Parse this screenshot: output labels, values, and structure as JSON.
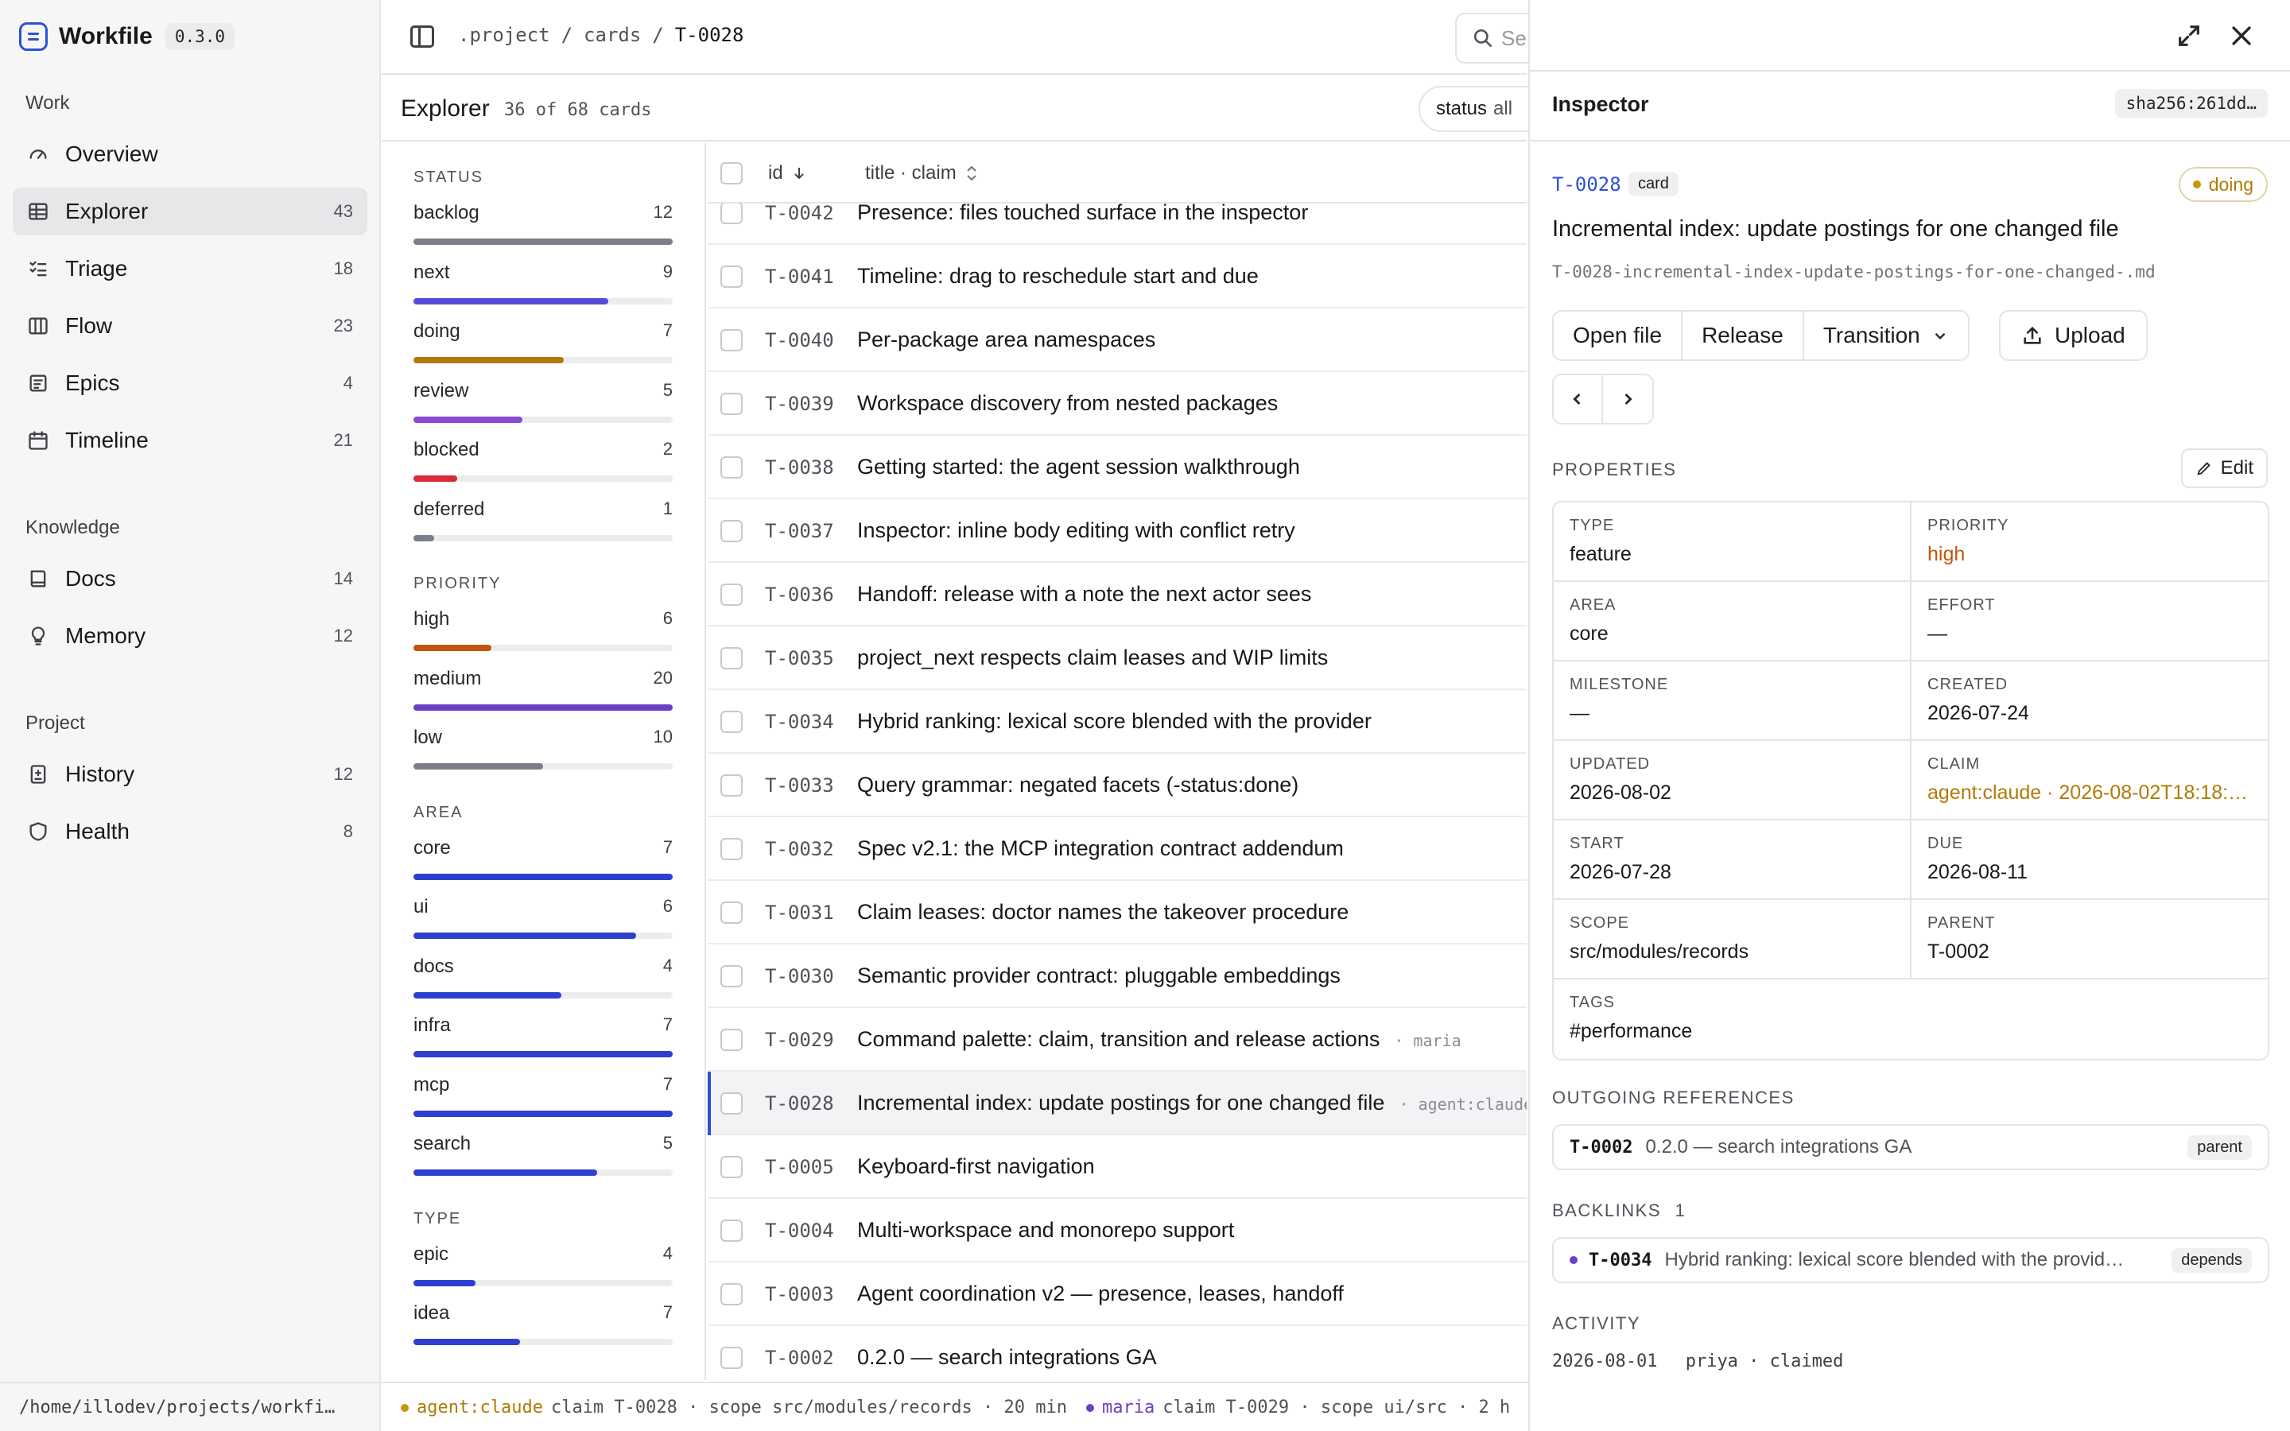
{
  "app": {
    "name": "Workfile",
    "version": "0.3.0"
  },
  "colors": {
    "accent": "#2f4fd8",
    "doing": "#b07a06",
    "high": "#c2560c",
    "purple": "#6d3fc4"
  },
  "sidebar": {
    "sections": [
      {
        "title": "Work",
        "items": [
          {
            "label": "Overview",
            "count": "",
            "icon": "gauge-icon"
          },
          {
            "label": "Explorer",
            "count": "43",
            "icon": "table-icon",
            "active": true
          },
          {
            "label": "Triage",
            "count": "18",
            "icon": "checklist-icon"
          },
          {
            "label": "Flow",
            "count": "23",
            "icon": "columns-icon"
          },
          {
            "label": "Epics",
            "count": "4",
            "icon": "epic-icon"
          },
          {
            "label": "Timeline",
            "count": "21",
            "icon": "calendar-icon"
          }
        ]
      },
      {
        "title": "Knowledge",
        "items": [
          {
            "label": "Docs",
            "count": "14",
            "icon": "book-icon"
          },
          {
            "label": "Memory",
            "count": "12",
            "icon": "bulb-icon"
          }
        ]
      },
      {
        "title": "Project",
        "items": [
          {
            "label": "History",
            "count": "12",
            "icon": "history-icon"
          },
          {
            "label": "Health",
            "count": "8",
            "icon": "shield-icon"
          }
        ]
      }
    ]
  },
  "topbar": {
    "breadcrumb": [
      ".project",
      "/",
      "cards",
      "/",
      "T-0028"
    ],
    "search_placeholder": "Se"
  },
  "explorer": {
    "title": "Explorer",
    "subtitle": "36 of 68 cards",
    "filter": {
      "label": "status",
      "value": "all"
    }
  },
  "facets": [
    {
      "head": "STATUS",
      "items": [
        {
          "label": "backlog",
          "count": "12",
          "fraction": 1.0,
          "color": "#7b7f8a"
        },
        {
          "label": "next",
          "count": "9",
          "fraction": 0.75,
          "color": "#5b4ad6"
        },
        {
          "label": "doing",
          "count": "7",
          "fraction": 0.58,
          "color": "#b07a06"
        },
        {
          "label": "review",
          "count": "5",
          "fraction": 0.42,
          "color": "#8b4ad6"
        },
        {
          "label": "blocked",
          "count": "2",
          "fraction": 0.17,
          "color": "#d92b3a"
        },
        {
          "label": "deferred",
          "count": "1",
          "fraction": 0.08,
          "color": "#7b7f8a"
        }
      ]
    },
    {
      "head": "PRIORITY",
      "items": [
        {
          "label": "high",
          "count": "6",
          "fraction": 0.3,
          "color": "#c2560c"
        },
        {
          "label": "medium",
          "count": "20",
          "fraction": 1.0,
          "color": "#6d3fc4"
        },
        {
          "label": "low",
          "count": "10",
          "fraction": 0.5,
          "color": "#7b7f8a"
        }
      ]
    },
    {
      "head": "AREA",
      "items": [
        {
          "label": "core",
          "count": "7",
          "fraction": 1.0,
          "color": "#2f3fd0"
        },
        {
          "label": "ui",
          "count": "6",
          "fraction": 0.86,
          "color": "#2f3fd0"
        },
        {
          "label": "docs",
          "count": "4",
          "fraction": 0.57,
          "color": "#2f3fd0"
        },
        {
          "label": "infra",
          "count": "7",
          "fraction": 1.0,
          "color": "#2f3fd0"
        },
        {
          "label": "mcp",
          "count": "7",
          "fraction": 1.0,
          "color": "#2f3fd0"
        },
        {
          "label": "search",
          "count": "5",
          "fraction": 0.71,
          "color": "#2f3fd0"
        }
      ]
    },
    {
      "head": "TYPE",
      "items": [
        {
          "label": "epic",
          "count": "4",
          "fraction": 0.24,
          "color": "#2f3fd0"
        },
        {
          "label": "idea",
          "count": "7",
          "fraction": 0.41,
          "color": "#2f3fd0"
        }
      ]
    }
  ],
  "table": {
    "columns": {
      "id": "id",
      "title": "title · claim"
    },
    "rows": [
      {
        "id": "T-0042",
        "title": "Presence: files touched surface in the inspector",
        "claim": ""
      },
      {
        "id": "T-0041",
        "title": "Timeline: drag to reschedule start and due",
        "claim": ""
      },
      {
        "id": "T-0040",
        "title": "Per-package area namespaces",
        "claim": ""
      },
      {
        "id": "T-0039",
        "title": "Workspace discovery from nested packages",
        "claim": ""
      },
      {
        "id": "T-0038",
        "title": "Getting started: the agent session walkthrough",
        "claim": ""
      },
      {
        "id": "T-0037",
        "title": "Inspector: inline body editing with conflict retry",
        "claim": ""
      },
      {
        "id": "T-0036",
        "title": "Handoff: release with a note the next actor sees",
        "claim": ""
      },
      {
        "id": "T-0035",
        "title": "project_next respects claim leases and WIP limits",
        "claim": ""
      },
      {
        "id": "T-0034",
        "title": "Hybrid ranking: lexical score blended with the provider",
        "claim": ""
      },
      {
        "id": "T-0033",
        "title": "Query grammar: negated facets (-status:done)",
        "claim": ""
      },
      {
        "id": "T-0032",
        "title": "Spec v2.1: the MCP integration contract addendum",
        "claim": ""
      },
      {
        "id": "T-0031",
        "title": "Claim leases: doctor names the takeover procedure",
        "claim": ""
      },
      {
        "id": "T-0030",
        "title": "Semantic provider contract: pluggable embeddings",
        "claim": ""
      },
      {
        "id": "T-0029",
        "title": "Command palette: claim, transition and release actions",
        "claim": "· maria"
      },
      {
        "id": "T-0028",
        "title": "Incremental index: update postings for one changed file",
        "claim": "· agent:claude",
        "selected": true
      },
      {
        "id": "T-0005",
        "title": "Keyboard-first navigation",
        "claim": ""
      },
      {
        "id": "T-0004",
        "title": "Multi-workspace and monorepo support",
        "claim": ""
      },
      {
        "id": "T-0003",
        "title": "Agent coordination v2 — presence, leases, handoff",
        "claim": ""
      },
      {
        "id": "T-0002",
        "title": "0.2.0 — search integrations GA",
        "claim": ""
      }
    ]
  },
  "inspector": {
    "title": "Inspector",
    "hash": "sha256:261dd…",
    "card_id": "T-0028",
    "kind": "card",
    "status": "doing",
    "card_title": "Incremental index: update postings for one changed file",
    "filename": "T-0028-incremental-index-update-postings-for-one-changed-.md",
    "actions": {
      "open": "Open file",
      "release": "Release",
      "transition": "Transition",
      "upload": "Upload"
    },
    "properties_label": "PROPERTIES",
    "edit_label": "Edit",
    "properties": [
      [
        {
          "k": "TYPE",
          "v": "feature"
        },
        {
          "k": "PRIORITY",
          "v": "high",
          "style": "warn"
        }
      ],
      [
        {
          "k": "AREA",
          "v": "core"
        },
        {
          "k": "EFFORT",
          "v": "—"
        }
      ],
      [
        {
          "k": "MILESTONE",
          "v": "—"
        },
        {
          "k": "CREATED",
          "v": "2026-07-24"
        }
      ],
      [
        {
          "k": "UPDATED",
          "v": "2026-08-02"
        },
        {
          "k": "CLAIM",
          "v": "agent:claude · 2026-08-02T18:18:…",
          "style": "claim"
        }
      ],
      [
        {
          "k": "START",
          "v": "2026-07-28"
        },
        {
          "k": "DUE",
          "v": "2026-08-11"
        }
      ],
      [
        {
          "k": "SCOPE",
          "v": "src/modules/records"
        },
        {
          "k": "PARENT",
          "v": "T-0002"
        }
      ],
      [
        {
          "k": "TAGS",
          "v": "#performance"
        }
      ]
    ],
    "outgoing_label": "OUTGOING REFERENCES",
    "outgoing": {
      "id": "T-0002",
      "title": "0.2.0 — search integrations GA",
      "tag": "parent"
    },
    "backlinks_label": "BACKLINKS",
    "backlinks_count": "1",
    "backlink": {
      "id": "T-0034",
      "title": "Hybrid ranking: lexical score blended with the provid…",
      "tag": "depends"
    },
    "activity_label": "ACTIVITY",
    "activity": {
      "date": "2026-08-01",
      "text": "priya · claimed"
    }
  },
  "statusbar": {
    "path": "/home/illodev/projects/workfi…",
    "presence": [
      {
        "who": "agent:claude",
        "text": "claim T-0028 · scope src/modules/records · 20 min"
      },
      {
        "who": "maria",
        "text": "claim T-0029 · scope ui/src · 2 h"
      }
    ]
  }
}
